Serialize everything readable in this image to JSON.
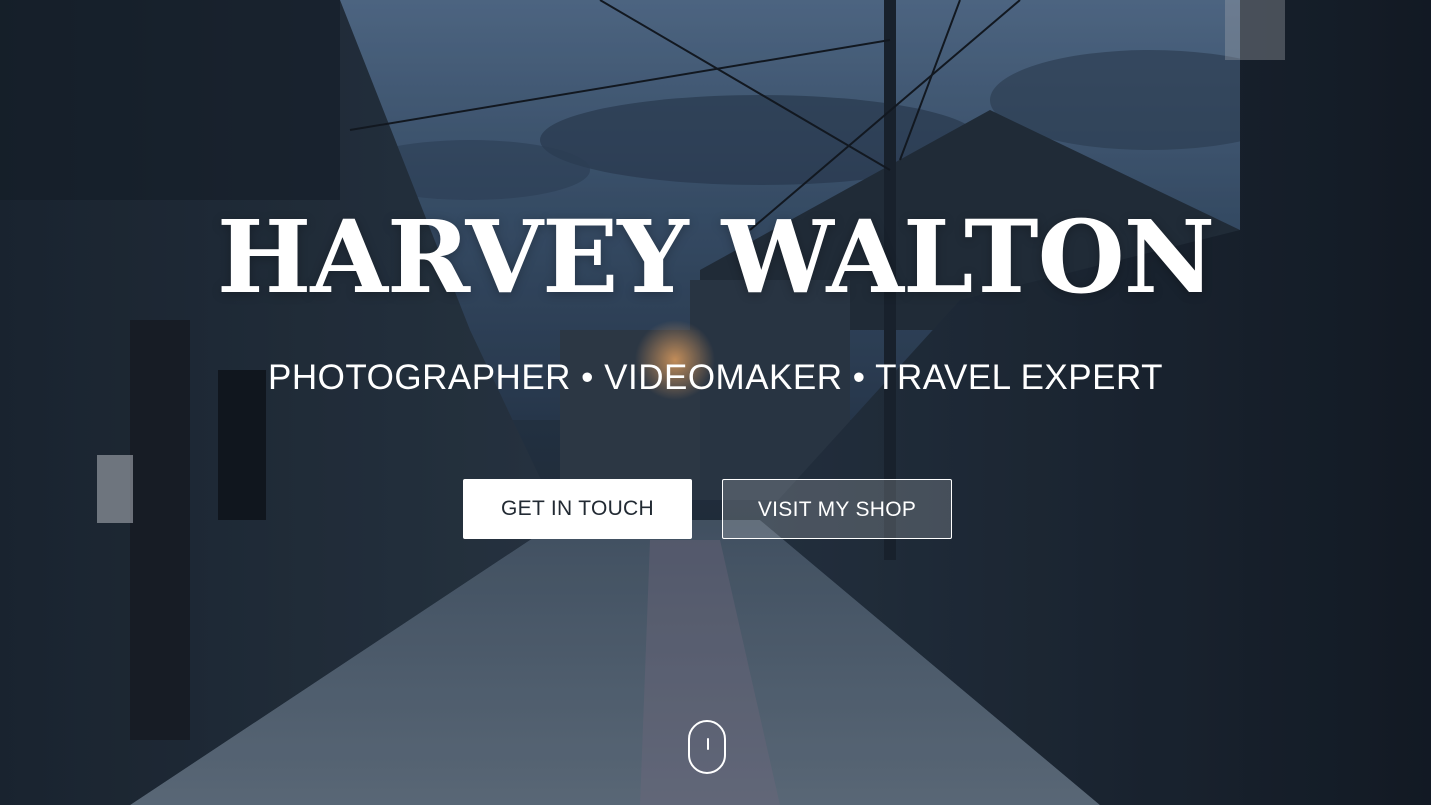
{
  "hero": {
    "title": "HARVEY WALTON",
    "tagline": "PHOTOGRAPHER • VIDEOMAKER • TRAVEL EXPERT",
    "background_icon": "street-scene-icon",
    "scroll_icon": "mouse-scroll-icon"
  },
  "buttons": {
    "get_in_touch": "GET IN TOUCH",
    "visit_shop": "VISIT MY SHOP"
  },
  "colors": {
    "text": "#ffffff",
    "primary_button_bg": "#ffffff",
    "primary_button_text": "#222a33"
  }
}
